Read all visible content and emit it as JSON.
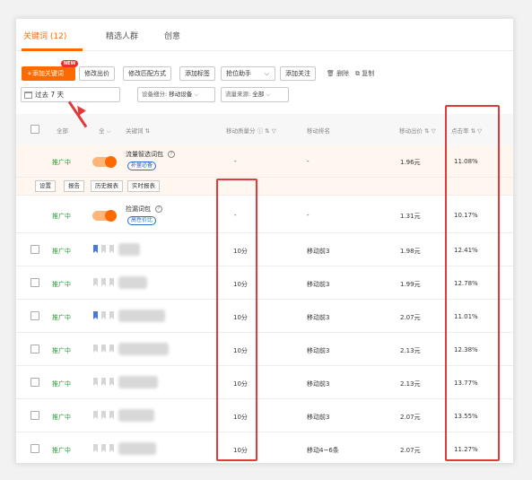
{
  "tabs": [
    {
      "label": "关键词 (12)",
      "active": true
    },
    {
      "label": "精选人群",
      "active": false
    },
    {
      "label": "创意",
      "active": false
    }
  ],
  "toolbar": {
    "add_keyword": "+添加关键词",
    "new_badge": "NEW",
    "edit_bid": "修改出价",
    "edit_match": "修改匹配方式",
    "add_tag": "添加标签",
    "rank_helper": "抢位助手",
    "add_follow": "添加关注",
    "delete": "删除",
    "copy": "复制"
  },
  "filters": {
    "date_range": "过去 7 天",
    "device_label": "设备细分:",
    "device_value": "移动设备",
    "source_label": "流量来源:",
    "source_value": "全部"
  },
  "table": {
    "headers": {
      "status_filter": "全部",
      "all_filter": "全",
      "keyword": "关键词",
      "quality_score": "移动质量分",
      "rank": "移动排名",
      "bid": "移动出价",
      "ctr": "点击率"
    },
    "packages": [
      {
        "status": "推广中",
        "name": "流量智选词包",
        "tag": "补量必备",
        "quality": "-",
        "rank": "-",
        "bid": "1.96元",
        "ctr": "11.08%"
      },
      {
        "status": "推广中",
        "name": "捡漏词包",
        "tag": "高性价比",
        "quality": "-",
        "rank": "-",
        "bid": "1.31元",
        "ctr": "10.17%"
      }
    ],
    "package_actions": [
      "设置",
      "报告",
      "历史报表",
      "实时报表"
    ],
    "rows": [
      {
        "status": "推广中",
        "quality": "10分",
        "rank": "移动前3",
        "bid": "1.98元",
        "ctr": "12.41%"
      },
      {
        "status": "推广中",
        "quality": "10分",
        "rank": "移动前3",
        "bid": "1.99元",
        "ctr": "12.78%"
      },
      {
        "status": "推广中",
        "quality": "10分",
        "rank": "移动前3",
        "bid": "2.07元",
        "ctr": "11.01%"
      },
      {
        "status": "推广中",
        "quality": "10分",
        "rank": "移动前3",
        "bid": "2.13元",
        "ctr": "12.38%"
      },
      {
        "status": "推广中",
        "quality": "10分",
        "rank": "移动前3",
        "bid": "2.13元",
        "ctr": "13.77%"
      },
      {
        "status": "推广中",
        "quality": "10分",
        "rank": "移动前3",
        "bid": "2.07元",
        "ctr": "13.55%"
      },
      {
        "status": "推广中",
        "quality": "10分",
        "rank": "移动4~6条",
        "bid": "2.07元",
        "ctr": "11.27%"
      }
    ]
  },
  "colors": {
    "accent": "#ff6a00",
    "status_green": "#2a9d3a",
    "annotation_red": "#e23a3a",
    "tag_blue": "#2f6bd1"
  }
}
